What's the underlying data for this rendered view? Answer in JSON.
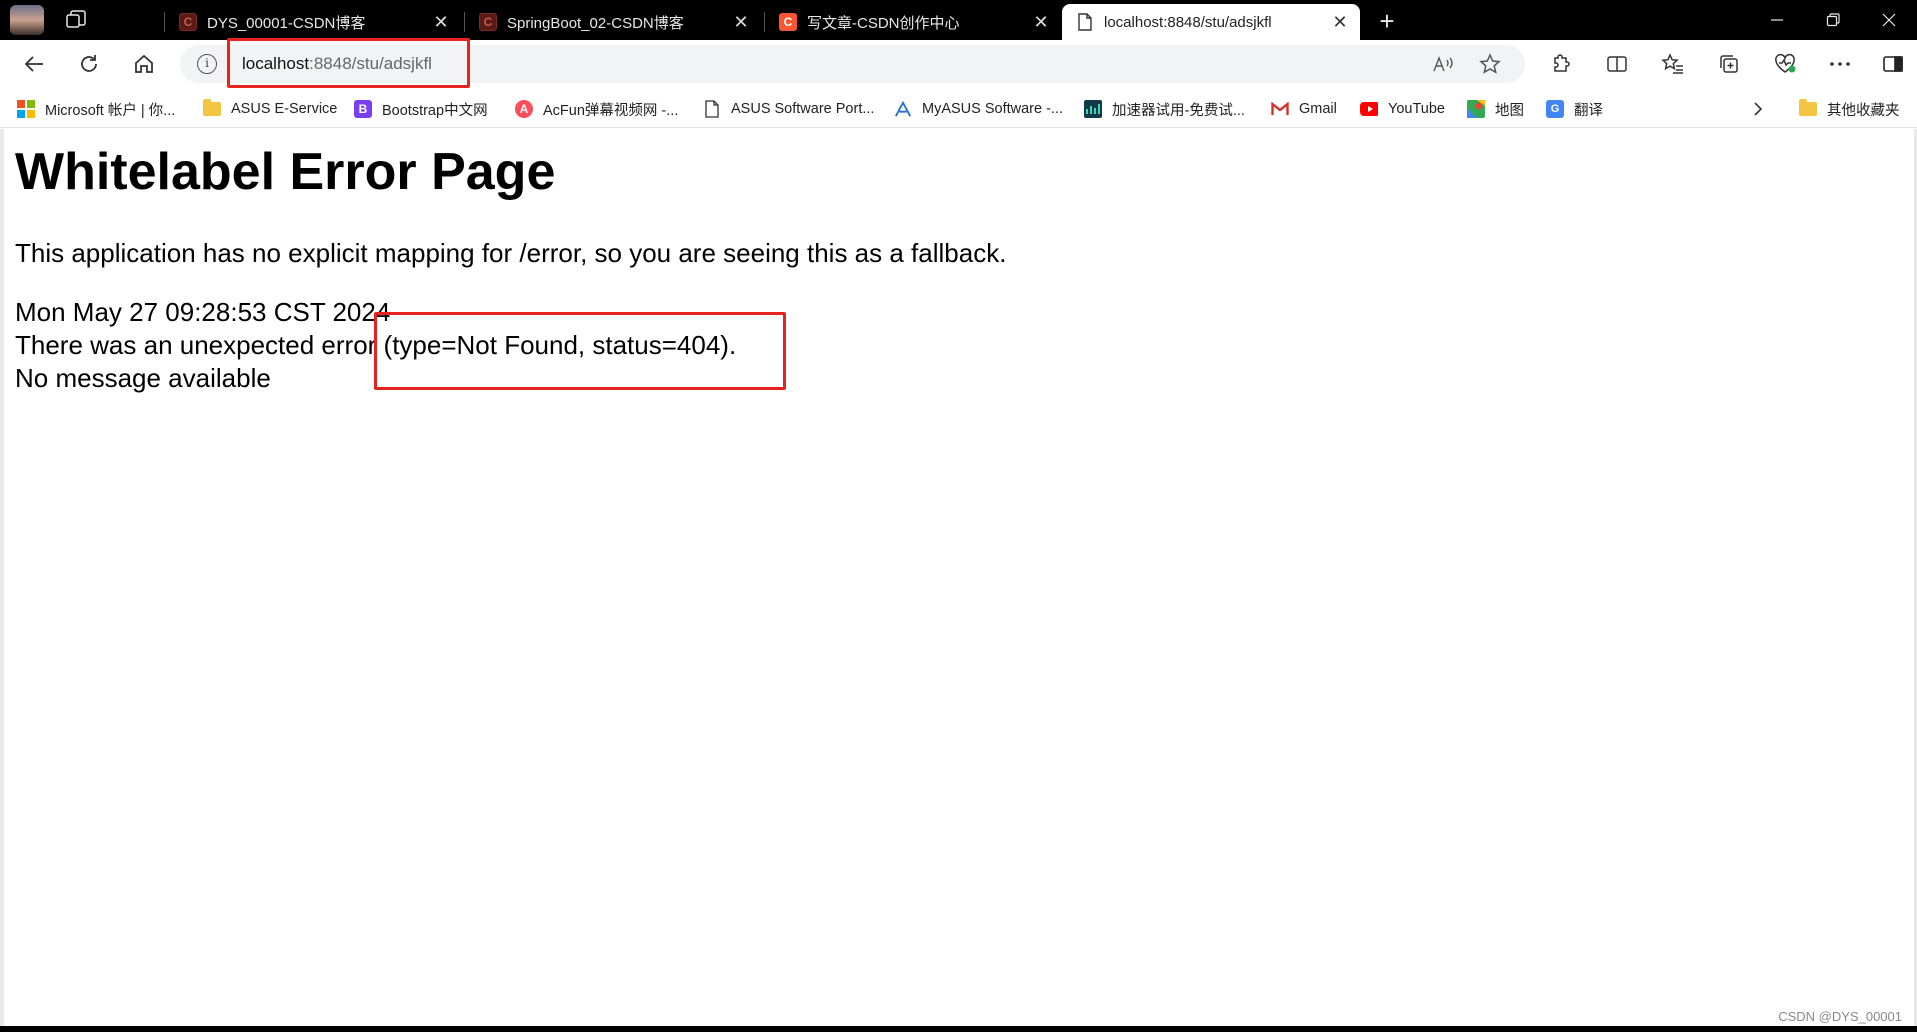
{
  "tabs": [
    {
      "title": "DYS_00001-CSDN博客",
      "favicon": "csdn-icon",
      "active": false
    },
    {
      "title": "SpringBoot_02-CSDN博客",
      "favicon": "csdn-icon",
      "active": false
    },
    {
      "title": "写文章-CSDN创作中心",
      "favicon": "csdn-icon",
      "active": false
    },
    {
      "title": "localhost:8848/stu/adsjkfl",
      "favicon": "page-icon",
      "active": true
    }
  ],
  "address": {
    "host": "localhost",
    "rest": ":8848/stu/adsjkfl"
  },
  "bookmarks": [
    {
      "label": "Microsoft 帐户 | 你...",
      "icon": "microsoft-icon"
    },
    {
      "label": "ASUS E-Service",
      "icon": "folder-icon"
    },
    {
      "label": "Bootstrap中文网",
      "icon": "bootstrap-icon"
    },
    {
      "label": "AcFun弹幕视频网 -...",
      "icon": "acfun-icon"
    },
    {
      "label": "ASUS Software Port...",
      "icon": "page-icon"
    },
    {
      "label": "MyASUS Software -...",
      "icon": "myasus-icon"
    },
    {
      "label": "加速器试用-免费试...",
      "icon": "accelerator-icon"
    },
    {
      "label": "Gmail",
      "icon": "gmail-icon"
    },
    {
      "label": "YouTube",
      "icon": "youtube-icon"
    },
    {
      "label": "地图",
      "icon": "maps-icon"
    },
    {
      "label": "翻译",
      "icon": "translate-icon"
    }
  ],
  "bookmarks_other": "其他收藏夹",
  "page": {
    "heading": "Whitelabel Error Page",
    "paragraph": "This application has no explicit mapping for /error, so you are seeing this as a fallback.",
    "line1": "Mon May 27 09:28:53 CST 2024",
    "line2": "There was an unexpected error (type=Not Found, status=404).",
    "line3": "No message available"
  },
  "watermark": "CSDN @DYS_00001",
  "colors": {
    "highlight": "#e8221e",
    "csdn": "#fc5531"
  }
}
